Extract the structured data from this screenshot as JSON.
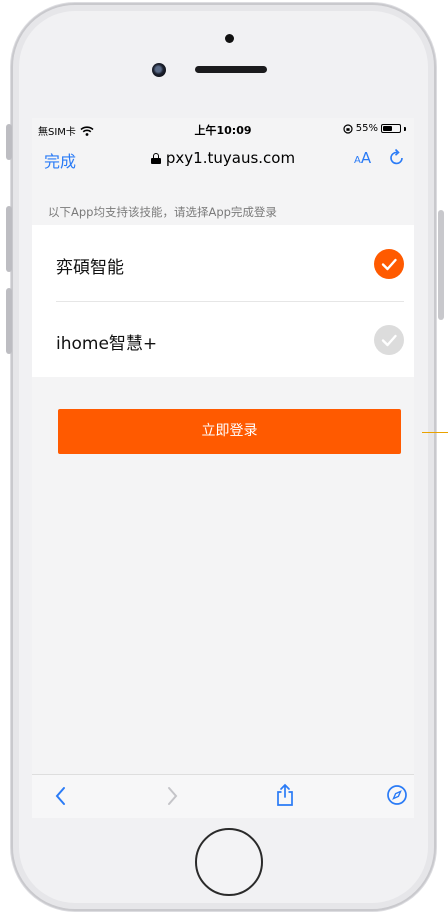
{
  "status_bar": {
    "carrier": "無SIM卡",
    "time": "上午10:09",
    "battery": "55%",
    "battery_level": 0.55
  },
  "browser": {
    "done_label": "完成",
    "url": "pxy1.tuyaus.com",
    "text_size_label_small": "A",
    "text_size_label_large": "A"
  },
  "page": {
    "hint": "以下App均支持该技能，请选择App完成登录",
    "apps": [
      {
        "name": "弈碩智能",
        "selected": true
      },
      {
        "name": "ihome智慧+",
        "selected": false
      }
    ],
    "login_label": "立即登录"
  },
  "colors": {
    "accent": "#ff5a00",
    "link": "#2a7bf6",
    "unchecked": "#dcdcdc"
  }
}
